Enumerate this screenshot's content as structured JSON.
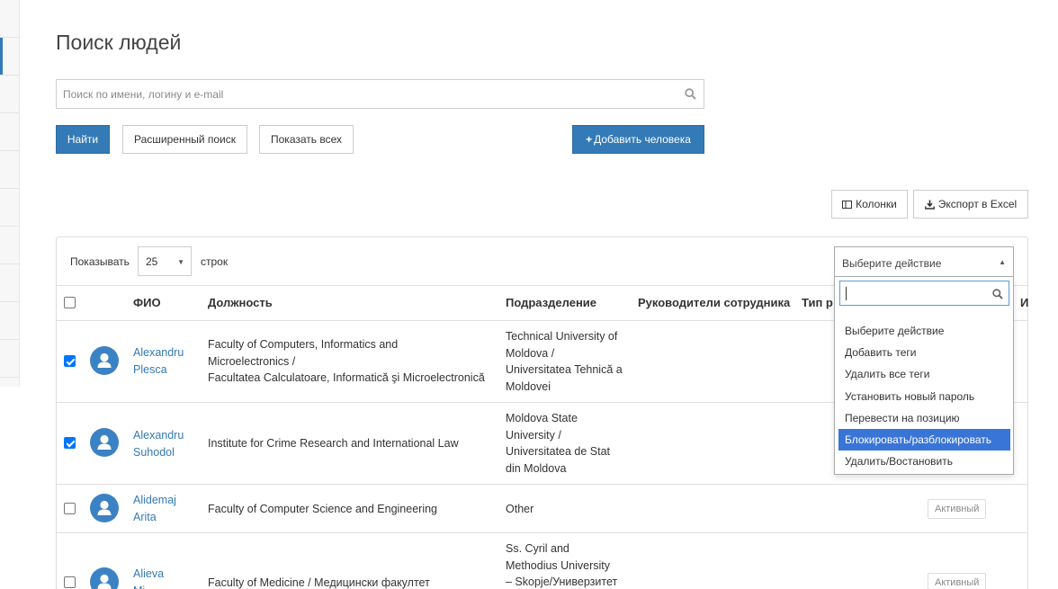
{
  "page": {
    "title": "Поиск людей"
  },
  "search": {
    "placeholder": "Поиск по имени, логину и e-mail"
  },
  "buttons": {
    "find": "Найти",
    "advanced": "Расширенный поиск",
    "show_all": "Показать всех",
    "add_person": "Добавить человека",
    "columns": "Колонки",
    "export": "Экспорт в Excel"
  },
  "toolbar": {
    "show_label": "Показывать",
    "rows_value": "25",
    "rows_label": "строк"
  },
  "action_select": {
    "selected": "Выберите действие",
    "options": [
      "Выберите действие",
      "Добавить теги",
      "Удалить все теги",
      "Установить новый пароль",
      "Перевести на позицию",
      "Блокировать/разблокировать",
      "Удалить/Востановить"
    ],
    "highlighted_index": 5
  },
  "table": {
    "headers": {
      "name": "ФИО",
      "position": "Должность",
      "department": "Подразделение",
      "managers": "Руководители сотрудника",
      "type": "Тип р",
      "extra": "И"
    },
    "rows": [
      {
        "checked": true,
        "name_line1": "Alexandru",
        "name_line2": "Plesca",
        "position_lines": [
          "Faculty of Computers, Informatics and",
          "Microelectronics /",
          "Facultatea Calculatoare, Informatică şi Microelectronică"
        ],
        "department_lines": [
          "Technical University of",
          "Moldova /",
          "Universitatea Tehnică a",
          "Moldovei"
        ],
        "status": ""
      },
      {
        "checked": true,
        "name_line1": "Alexandru",
        "name_line2": "Suhodol",
        "position_lines": [
          "Institute for Crime Research and International Law"
        ],
        "department_lines": [
          "Moldova State",
          "University /",
          "Universitatea de Stat",
          "din Moldova"
        ],
        "status": ""
      },
      {
        "checked": false,
        "name_line1": "Alidemaj",
        "name_line2": "Arita",
        "position_lines": [
          "Faculty of Computer Science and Engineering"
        ],
        "department_lines": [
          "Other"
        ],
        "status": "Активный"
      },
      {
        "checked": false,
        "name_line1": "Alieva",
        "name_line2": "Mi",
        "position_lines": [
          "Faculty of Medicine / Медицински факултет"
        ],
        "department_lines": [
          "Ss. Cyril and",
          "Methodius University",
          "– Skopje/Универзитет"
        ],
        "status": "Активный"
      }
    ]
  },
  "colors": {
    "primary": "#337ab7",
    "highlight": "#3875d7",
    "link": "#337ab7",
    "avatar": "#3b82c4"
  }
}
